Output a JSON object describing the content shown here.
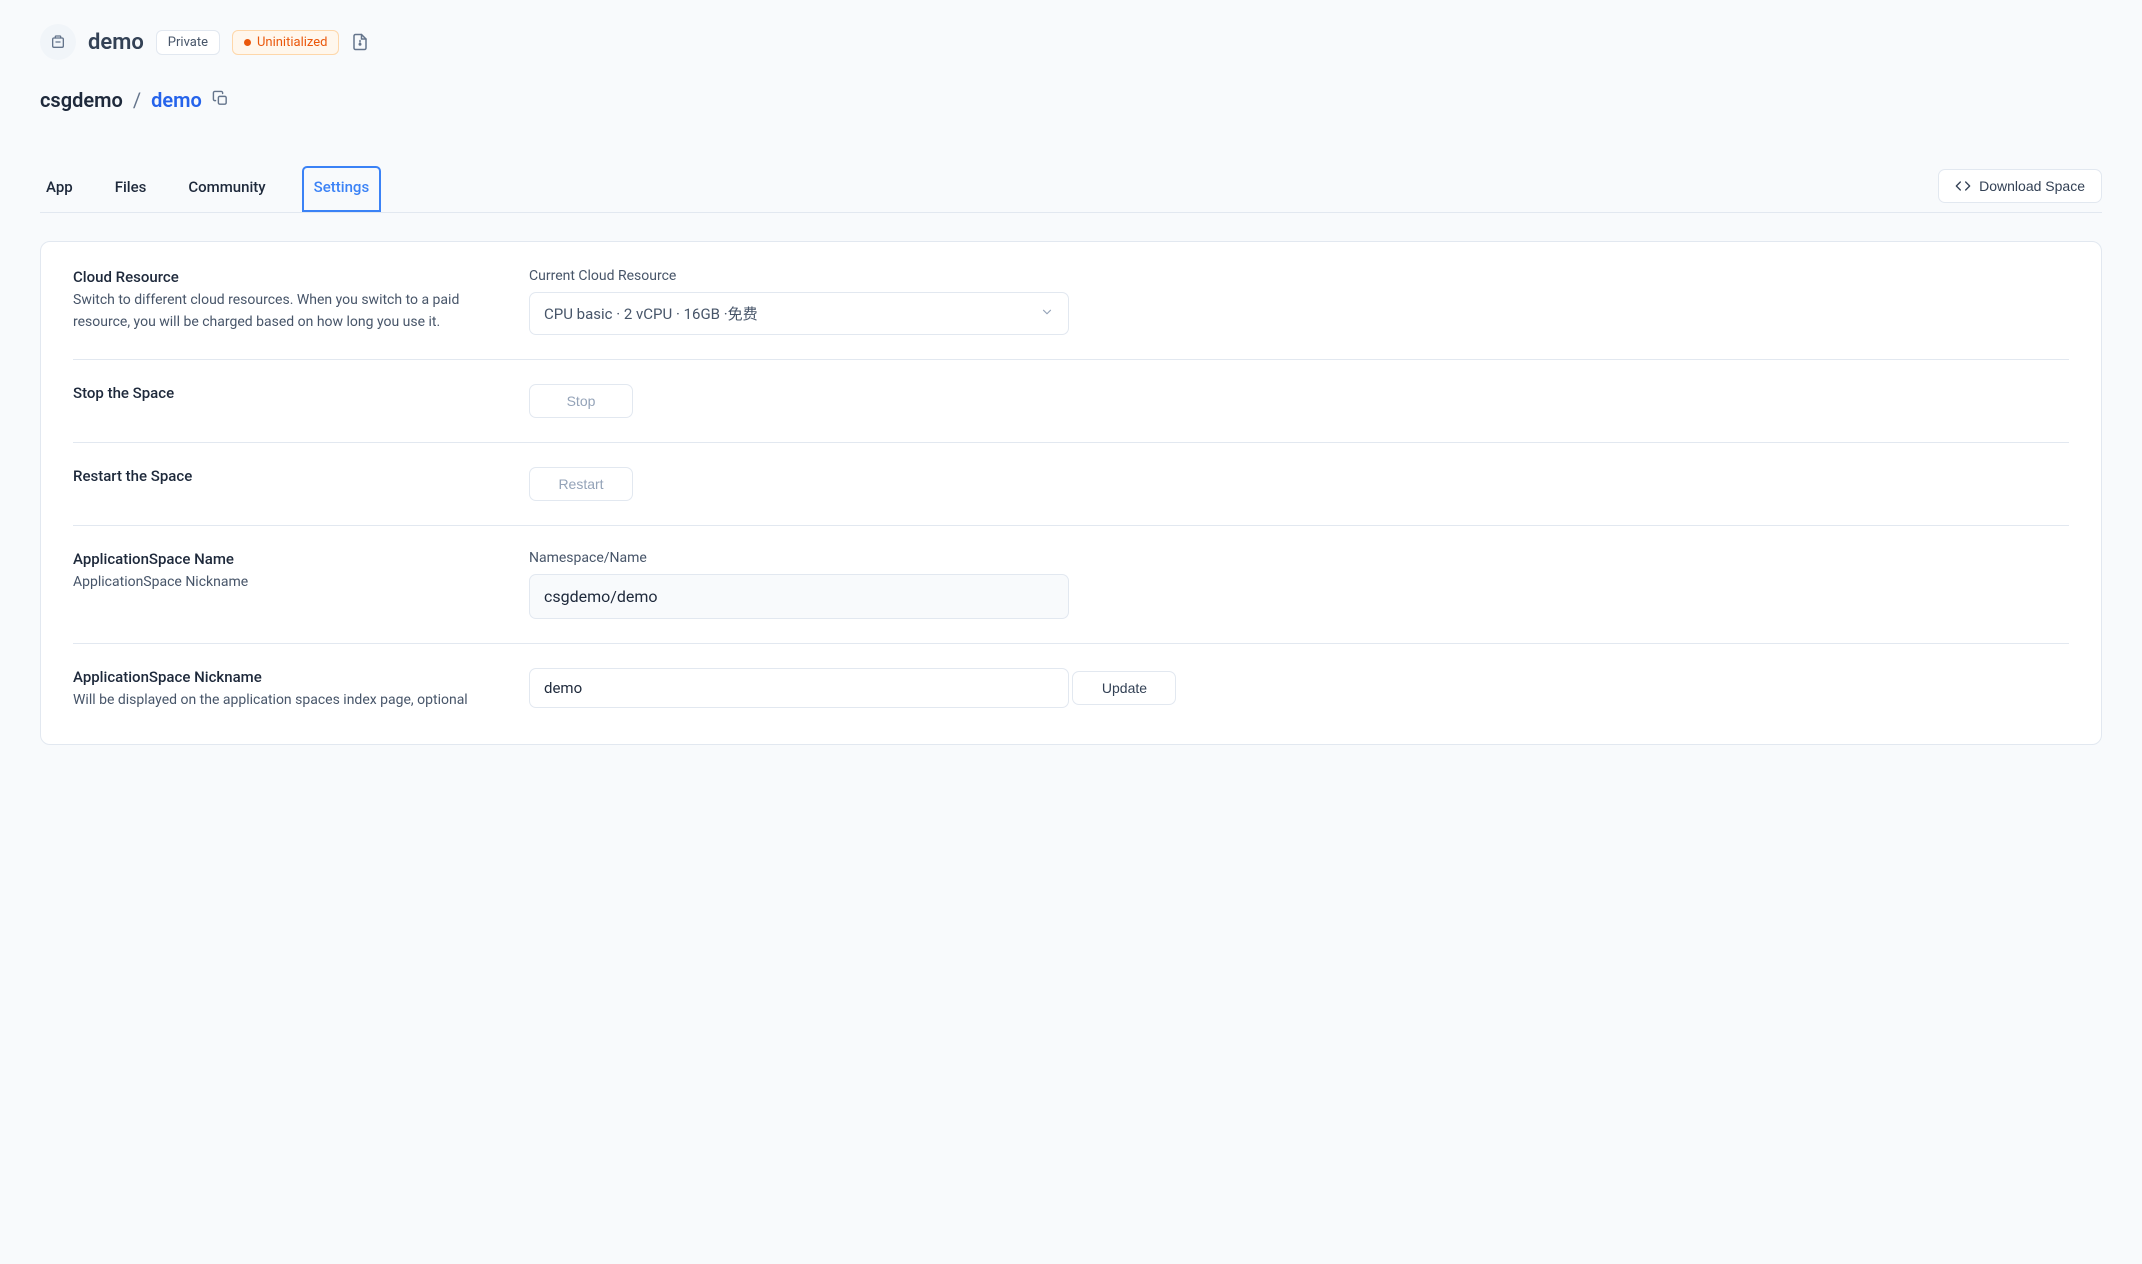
{
  "header": {
    "title": "demo",
    "visibility_label": "Private",
    "status_label": "Uninitialized"
  },
  "breadcrumb": {
    "owner": "csgdemo",
    "separator": "/",
    "name": "demo"
  },
  "tabs": {
    "items": [
      {
        "label": "App"
      },
      {
        "label": "Files"
      },
      {
        "label": "Community"
      },
      {
        "label": "Settings"
      }
    ],
    "active_index": 3,
    "download_label": "Download Space"
  },
  "settings": {
    "cloud": {
      "title": "Cloud Resource",
      "desc": "Switch to different cloud resources. When you switch to a paid resource, you will be charged based on how long you use it.",
      "right_label": "Current Cloud Resource",
      "selected": "CPU basic · 2 vCPU · 16GB ·免费"
    },
    "stop": {
      "title": "Stop the Space",
      "button": "Stop"
    },
    "restart": {
      "title": "Restart the Space",
      "button": "Restart"
    },
    "name": {
      "title": "ApplicationSpace Name",
      "desc": "ApplicationSpace Nickname",
      "right_label": "Namespace/Name",
      "value": "csgdemo/demo"
    },
    "nickname": {
      "title": "ApplicationSpace Nickname",
      "desc": "Will be displayed on the application spaces index page, optional",
      "value": "demo",
      "button": "Update"
    }
  }
}
